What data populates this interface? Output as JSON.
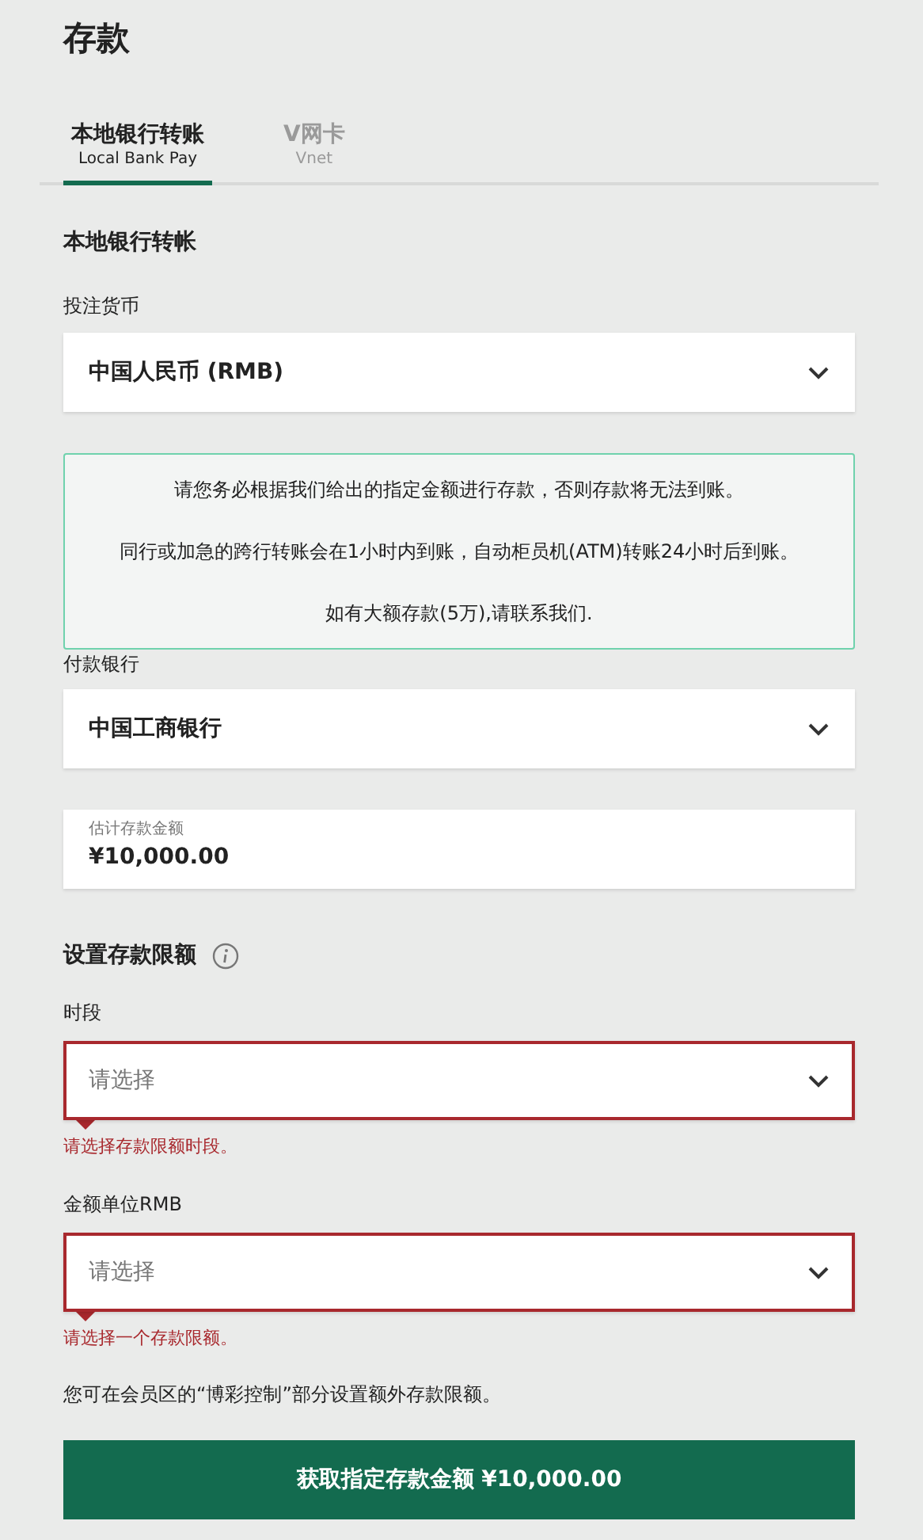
{
  "page_title": "存款",
  "tabs": [
    {
      "label": "本地银行转账",
      "sublabel": "Local Bank Pay",
      "selected": true
    },
    {
      "label": "V网卡",
      "sublabel": "Vnet",
      "selected": false
    }
  ],
  "section_title": "本地银行转帐",
  "currency": {
    "label": "投注货币",
    "value": "中国人民币 (RMB)"
  },
  "notice": [
    "请您务必根据我们给出的指定金额进行存款，否则存款将无法到账。",
    "同行或加急的跨行转账会在1小时内到账，自动柜员机(ATM)转账24小时后到账。",
    "如有大额存款(5万),请联系我们."
  ],
  "bank": {
    "label": "付款银行",
    "value": "中国工商银行"
  },
  "amount": {
    "label": "估计存款金额",
    "value": "¥10,000.00"
  },
  "limits": {
    "title": "设置存款限额",
    "fields": [
      {
        "label": "时段",
        "placeholder": "请选择",
        "error": "请选择存款限额时段。"
      },
      {
        "label": "金额单位RMB",
        "placeholder": "请选择",
        "error": "请选择一个存款限额。"
      }
    ]
  },
  "note": "您可在会员区的“博彩控制”部分设置额外存款限额。",
  "submit": "获取指定存款金额 ¥10,000.00"
}
